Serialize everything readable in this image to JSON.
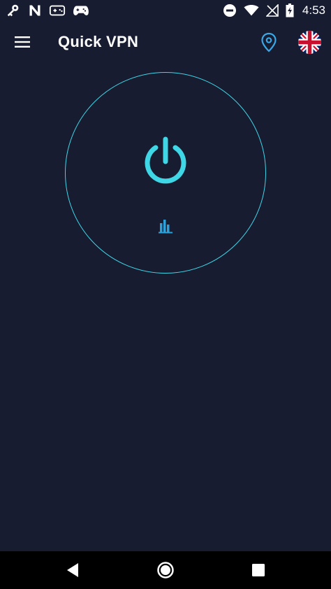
{
  "status_bar": {
    "time": "4:53",
    "left_icons": [
      "key-icon",
      "n-notification-icon",
      "gamepad-icon",
      "controller-icon"
    ],
    "right_icons": [
      "do-not-disturb-icon",
      "wifi-icon",
      "no-signal-icon",
      "battery-charging-icon"
    ]
  },
  "toolbar": {
    "title": "Quick VPN",
    "menu_icon": "hamburger-menu-icon",
    "location_icon": "map-pin-icon",
    "server_flag": "uk-flag-icon"
  },
  "connect": {
    "power_icon": "power-icon",
    "stats_icon": "bar-chart-icon"
  },
  "nav_bar": {
    "icons": [
      "back-icon",
      "home-icon",
      "recent-apps-icon"
    ]
  },
  "colors": {
    "background": "#171c31",
    "accent": "#3fd6e6",
    "location_icon": "#3aa7e6",
    "nav_bar": "#000000"
  }
}
